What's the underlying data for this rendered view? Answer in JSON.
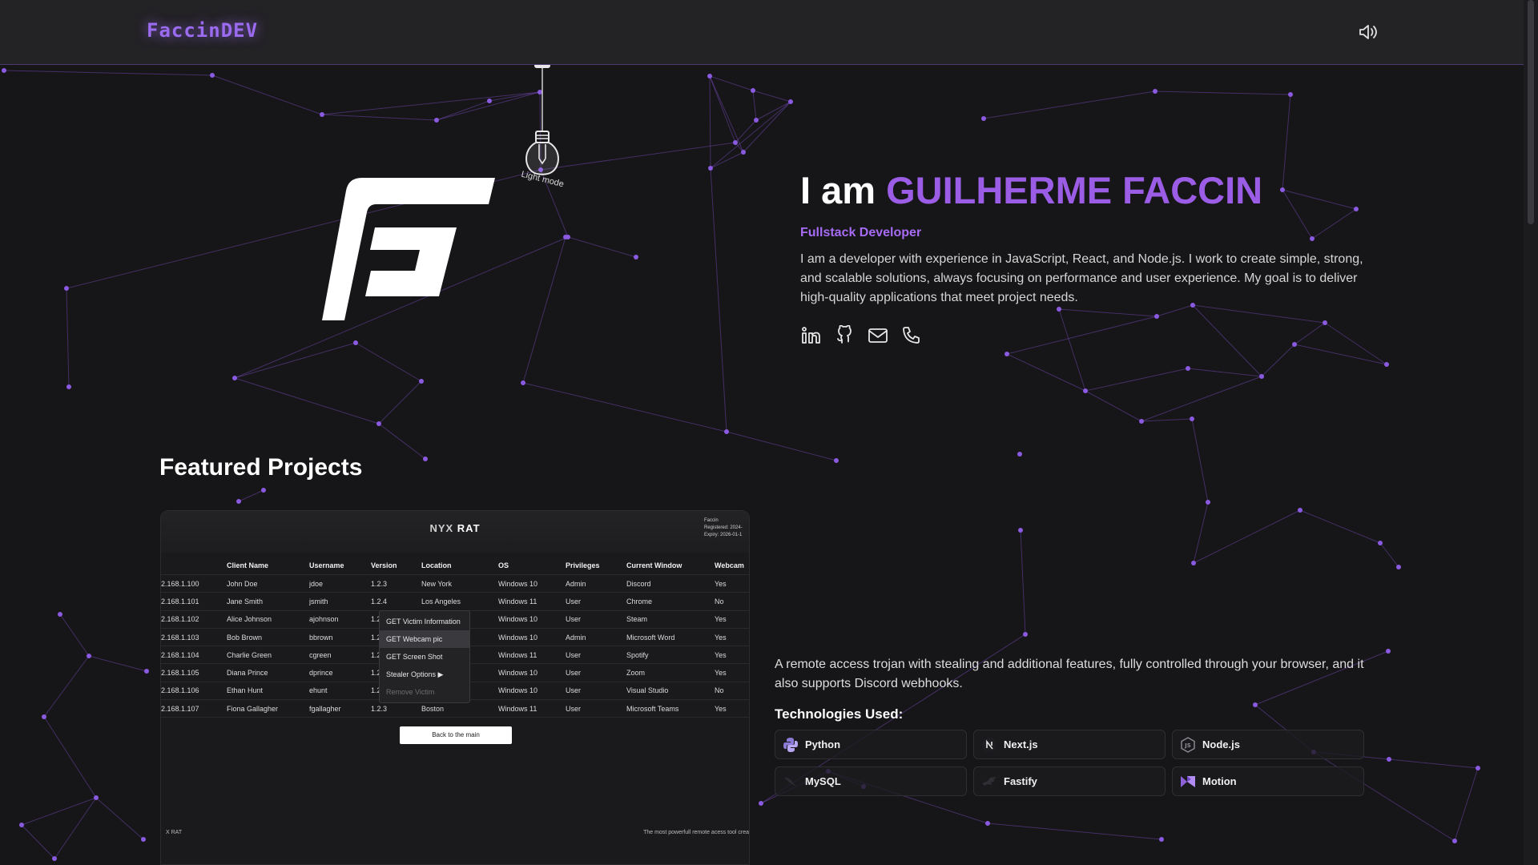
{
  "header": {
    "brand": "FaccinDEV",
    "sound_icon": "speaker-volume-icon"
  },
  "lamp": {
    "label": "Light mode",
    "icon": "lightbulb-icon"
  },
  "logo": {
    "icon": "fg-monogram-logo"
  },
  "hero": {
    "greeting": "I am",
    "name": "GUILHERME FACCIN",
    "role": "Fullstack Developer",
    "bio": "I am a developer with experience in JavaScript, React, and Node.js. I work to create simple, strong, and scalable solutions, always focusing on performance and user experience. My goal is to deliver high-quality applications that meet project needs.",
    "socials": [
      "linkedin-icon",
      "github-icon",
      "mail-icon",
      "phone-icon"
    ]
  },
  "featured": {
    "title": "Featured Projects",
    "preview": {
      "title_prefix": "NYX",
      "title_main": "RAT",
      "user_name": "Faccin",
      "user_registered": "Registered: 2024-",
      "user_expiry": "Expiry: 2026-01-1",
      "columns": [
        "",
        "Client Name",
        "Username",
        "Version",
        "Location",
        "OS",
        "Privileges",
        "Current Window",
        "Webcam"
      ],
      "rows": [
        [
          "2.168.1.100",
          "John Doe",
          "jdoe",
          "1.2.3",
          "New York",
          "Windows 10",
          "Admin",
          "Discord",
          "Yes"
        ],
        [
          "2.168.1.101",
          "Jane Smith",
          "jsmith",
          "1.2.4",
          "Los Angeles",
          "Windows 11",
          "User",
          "Chrome",
          "No"
        ],
        [
          "2.168.1.102",
          "Alice Johnson",
          "ajohnson",
          "1.2",
          "",
          "Windows 10",
          "User",
          "Steam",
          "Yes"
        ],
        [
          "2.168.1.103",
          "Bob Brown",
          "bbrown",
          "1.2",
          "",
          "Windows 10",
          "Admin",
          "Microsoft Word",
          "Yes"
        ],
        [
          "2.168.1.104",
          "Charlie Green",
          "cgreen",
          "1.2",
          "",
          "Windows 11",
          "User",
          "Spotify",
          "Yes"
        ],
        [
          "2.168.1.105",
          "Diana Prince",
          "dprince",
          "1.2",
          "",
          "Windows 10",
          "User",
          "Zoom",
          "Yes"
        ],
        [
          "2.168.1.106",
          "Ethan Hunt",
          "ehunt",
          "1.2",
          "",
          "Windows 10",
          "User",
          "Visual Studio",
          "No"
        ],
        [
          "2.168.1.107",
          "Fiona Gallagher",
          "fgallagher",
          "1.2.3",
          "Boston",
          "Windows 11",
          "User",
          "Microsoft Teams",
          "Yes"
        ]
      ],
      "context_menu": [
        "GET Victim Information",
        "GET Webcam pic",
        "GET Screen Shot",
        "Stealer Options ▶",
        "Remove Victim"
      ],
      "back_button": "Back to the main",
      "footer_left": "X RAT",
      "footer_right": "The most powerfull remote acess tool crea"
    },
    "description": "A remote access trojan with stealing and additional features, fully controlled through your browser, and it also supports Discord webhooks.",
    "tech_title": "Technologies Used:",
    "technologies": [
      {
        "label": "Python",
        "icon": "python-icon"
      },
      {
        "label": "Next.js",
        "icon": "nextjs-icon"
      },
      {
        "label": "Node.js",
        "icon": "nodejs-icon"
      },
      {
        "label": "MySQL",
        "icon": "mysql-icon"
      },
      {
        "label": "Fastify",
        "icon": "fastify-icon"
      },
      {
        "label": "Motion",
        "icon": "motion-icon"
      }
    ]
  },
  "colors": {
    "accent": "#9b5de5",
    "background": "#161517",
    "header": "#232225",
    "network": "#7b4fc4"
  }
}
